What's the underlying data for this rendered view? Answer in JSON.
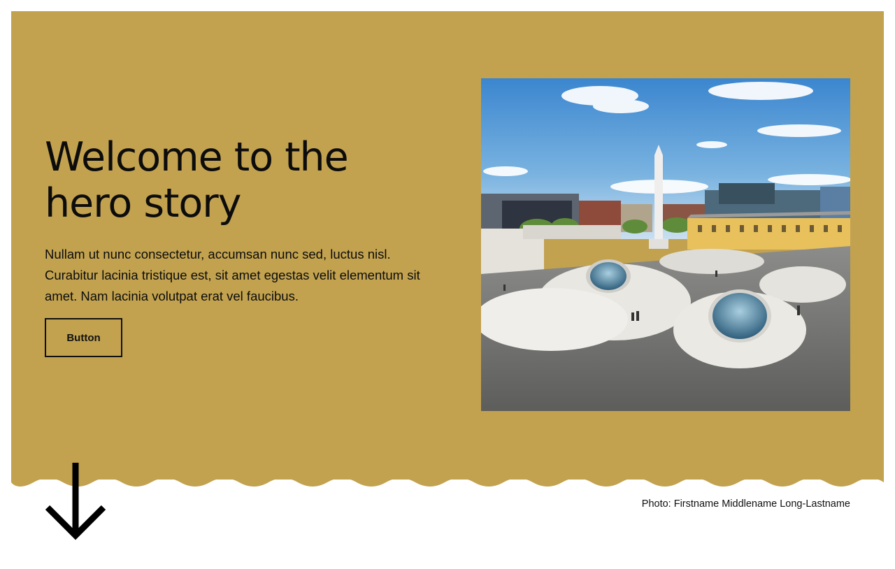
{
  "hero": {
    "title": "Welcome to the hero story",
    "text": "Nullam ut nunc consectetur, accumsan nunc sed, luctus nisl. Curabitur lacinia tristique est, sit amet egestas velit elementum sit amet. Nam lacinia volutpat erat vel faucibus.",
    "button_label": "Button",
    "background_color": "#c2a24f"
  },
  "image": {
    "subject": "public square with domed skylights in front of city buildings"
  },
  "scroll": {
    "icon": "arrow-down-icon"
  },
  "photo_credit": "Photo: Firstname Middlename Long-Lastname"
}
